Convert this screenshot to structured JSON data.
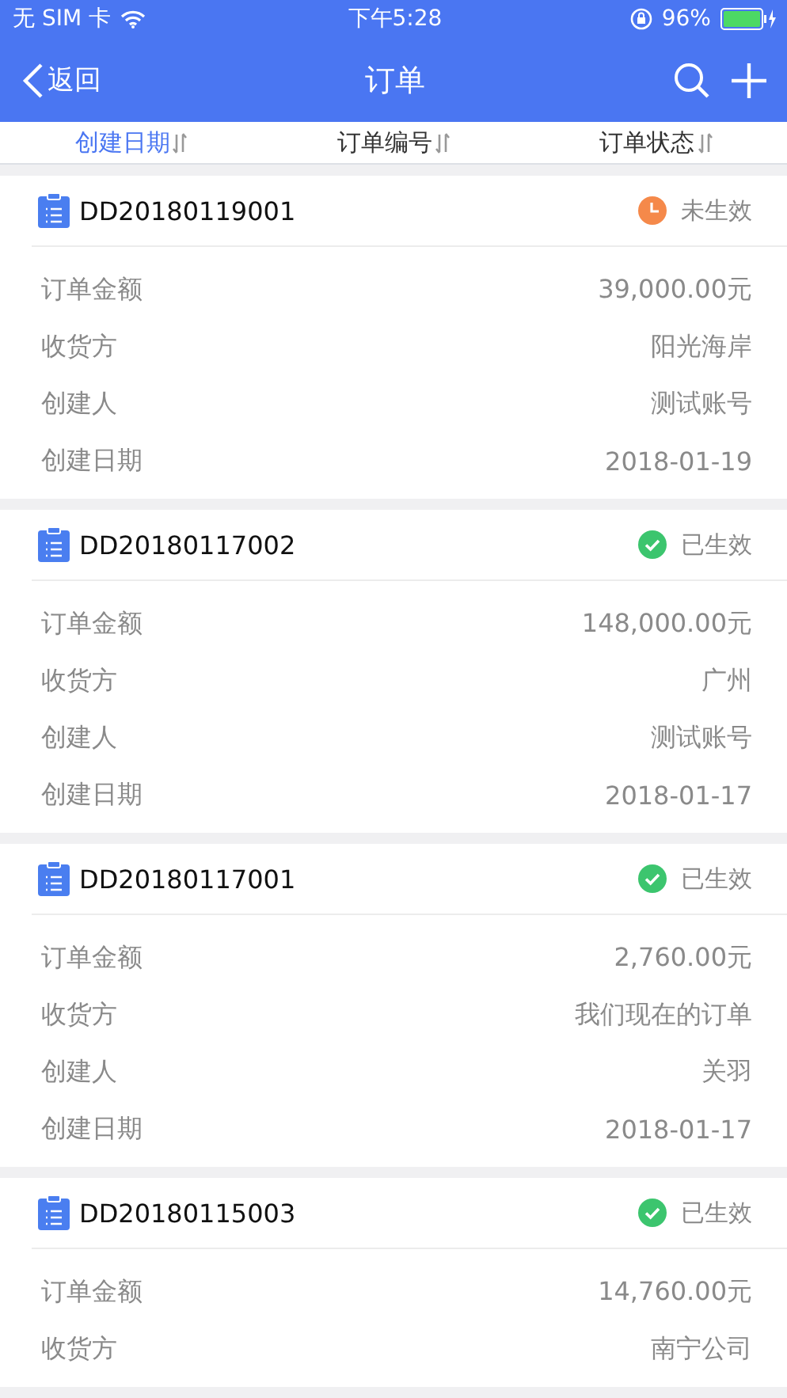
{
  "status_bar": {
    "carrier": "无 SIM 卡",
    "time": "下午5:28",
    "battery": "96%"
  },
  "nav_bar": {
    "back": "返回",
    "title": "订单"
  },
  "sort_tabs": [
    {
      "label": "创建日期",
      "selected": true
    },
    {
      "label": "订单编号",
      "selected": false
    },
    {
      "label": "订单状态",
      "selected": false
    }
  ],
  "orders": [
    {
      "number": "DD20180119001",
      "status": "未生效",
      "kind": "pending",
      "fields": [
        {
          "label": "订单金额",
          "value": "39,000.00元"
        },
        {
          "label": "收货方",
          "value": "阳光海岸"
        },
        {
          "label": "创建人",
          "value": "测试账号"
        },
        {
          "label": "创建日期",
          "value": "2018-01-19"
        }
      ]
    },
    {
      "number": "DD20180117002",
      "status": "已生效",
      "kind": "active",
      "fields": [
        {
          "label": "订单金额",
          "value": "148,000.00元"
        },
        {
          "label": "收货方",
          "value": "广州"
        },
        {
          "label": "创建人",
          "value": "测试账号"
        },
        {
          "label": "创建日期",
          "value": "2018-01-17"
        }
      ]
    },
    {
      "number": "DD20180117001",
      "status": "已生效",
      "kind": "active",
      "fields": [
        {
          "label": "订单金额",
          "value": "2,760.00元"
        },
        {
          "label": "收货方",
          "value": "我们现在的订单"
        },
        {
          "label": "创建人",
          "value": "关羽"
        },
        {
          "label": "创建日期",
          "value": "2018-01-17"
        }
      ]
    },
    {
      "number": "DD20180115003",
      "status": "已生效",
      "kind": "active",
      "fields": [
        {
          "label": "订单金额",
          "value": "14,760.00元"
        },
        {
          "label": "收货方",
          "value": "南宁公司"
        }
      ]
    }
  ]
}
